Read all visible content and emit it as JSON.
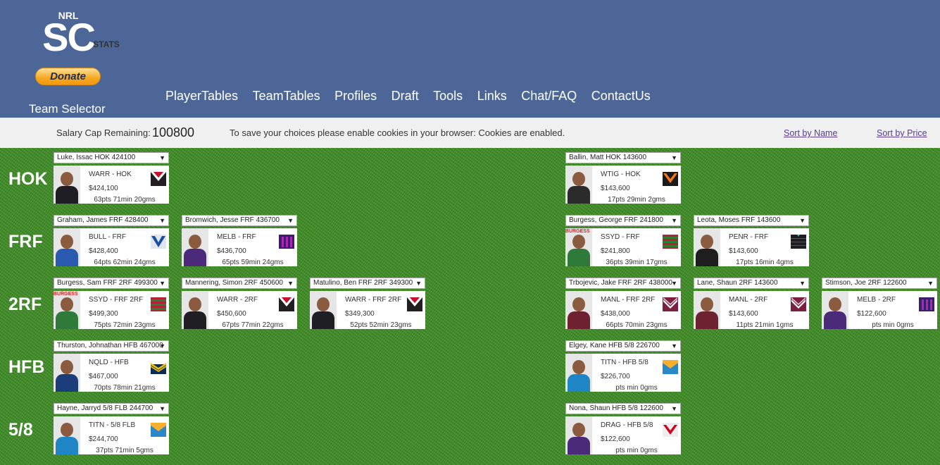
{
  "header": {
    "logo": {
      "top": "NRL",
      "main": "SC",
      "bottom": "STATS"
    },
    "donate_label": "Donate",
    "page_title": "Team Selector",
    "nav": [
      "PlayerTables",
      "TeamTables",
      "Profiles",
      "Draft",
      "Tools",
      "Links",
      "Chat/FAQ",
      "ContactUs"
    ]
  },
  "infobar": {
    "cap_label": "Salary Cap Remaining:",
    "cap_value": "100800",
    "cookie_message": "To save your choices please enable cookies in your browser: Cookies are enabled.",
    "sort_by_name": "Sort by Name",
    "sort_by_price": "Sort by Price"
  },
  "positions": [
    {
      "label": "HOK"
    },
    {
      "label": "FRF"
    },
    {
      "label": "2RF"
    },
    {
      "label": "HFB"
    },
    {
      "label": "5/8"
    }
  ],
  "slots": [
    {
      "select": "Luke, Issac HOK 424100",
      "team_pos": "WARR - HOK",
      "price": "$424,100",
      "stats": "63pts 71min 20gms",
      "team": "WARR",
      "logo_icon": "warriors-logo-icon"
    },
    {
      "select": "Ballin, Matt HOK 143600",
      "team_pos": "WTIG - HOK",
      "price": "$143,600",
      "stats": "17pts 29min 2gms",
      "team": "WTIG",
      "logo_icon": "tigers-logo-icon"
    },
    {
      "select": "Graham, James FRF 428400",
      "team_pos": "BULL - FRF",
      "price": "$428,400",
      "stats": "64pts 62min 24gms",
      "team": "BULL",
      "logo_icon": "bulldogs-logo-icon"
    },
    {
      "select": "Bromwich, Jesse FRF 436700",
      "team_pos": "MELB - FRF",
      "price": "$436,700",
      "stats": "65pts 59min 24gms",
      "team": "MELB",
      "logo_icon": "storm-logo-icon"
    },
    {
      "select": "Burgess, George FRF 241800",
      "team_pos": "SSYD - FRF",
      "price": "$241,800",
      "stats": "36pts 39min 17gms",
      "team": "SSYD",
      "logo_icon": "rabbitohs-logo-icon",
      "banner": "BURGESS"
    },
    {
      "select": "Leota, Moses FRF 143600",
      "team_pos": "PENR - FRF",
      "price": "$143,600",
      "stats": "17pts 16min 4gms",
      "team": "PENR",
      "logo_icon": "panthers-logo-icon"
    },
    {
      "select": "Burgess, Sam FRF 2RF 499300",
      "team_pos": "SSYD - FRF 2RF",
      "price": "$499,300",
      "stats": "75pts 72min 23gms",
      "team": "SSYD",
      "logo_icon": "rabbitohs-logo-icon",
      "banner": "BURGESS"
    },
    {
      "select": "Mannering, Simon 2RF 450600",
      "team_pos": "WARR - 2RF",
      "price": "$450,600",
      "stats": "67pts 77min 22gms",
      "team": "WARR",
      "logo_icon": "warriors-logo-icon"
    },
    {
      "select": "Matulino, Ben FRF 2RF 349300",
      "team_pos": "WARR - FRF 2RF",
      "price": "$349,300",
      "stats": "52pts 52min 23gms",
      "team": "WARR",
      "logo_icon": "warriors-logo-icon"
    },
    {
      "select": "Trbojevic, Jake FRF 2RF 438000",
      "team_pos": "MANL - FRF 2RF",
      "price": "$438,000",
      "stats": "66pts 70min 23gms",
      "team": "MANL",
      "logo_icon": "sea-eagles-logo-icon"
    },
    {
      "select": "Lane, Shaun 2RF 143600",
      "team_pos": "MANL - 2RF",
      "price": "$143,600",
      "stats": "11pts 21min 1gms",
      "team": "MANL",
      "logo_icon": "sea-eagles-logo-icon"
    },
    {
      "select": "Stimson, Joe 2RF 122600",
      "team_pos": "MELB - 2RF",
      "price": "$122,600",
      "stats": "pts min 0gms",
      "team": "MELB",
      "logo_icon": "storm-logo-icon"
    },
    {
      "select": "Thurston, Johnathan HFB 467000",
      "team_pos": "NQLD - HFB",
      "price": "$467,000",
      "stats": "70pts 78min 21gms",
      "team": "NQLD",
      "logo_icon": "cowboys-logo-icon"
    },
    {
      "select": "Elgey, Kane HFB 5/8 226700",
      "team_pos": "TITN - HFB 5/8",
      "price": "$226,700",
      "stats": "pts min 0gms",
      "team": "TITN",
      "logo_icon": "titans-logo-icon"
    },
    {
      "select": "Hayne, Jarryd 5/8 FLB 244700",
      "team_pos": "TITN - 5/8 FLB",
      "price": "$244,700",
      "stats": "37pts 71min 5gms",
      "team": "TITN",
      "logo_icon": "titans-logo-icon"
    },
    {
      "select": "Nona, Shaun HFB 5/8 122600",
      "team_pos": "DRAG - HFB 5/8",
      "price": "$122,600",
      "stats": "pts min 0gms",
      "team": "DRAG",
      "logo_icon": "dragons-logo-icon"
    }
  ],
  "colors": {
    "header_bg": "#4c6797",
    "infobar_bg": "#f0f0f0",
    "field_green": "#3c8b23",
    "sort_link": "#5a3c8a"
  }
}
